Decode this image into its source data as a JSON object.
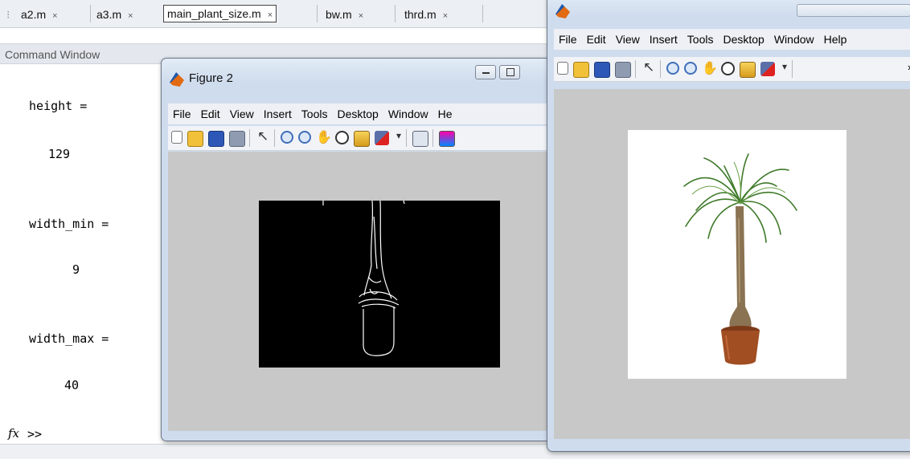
{
  "editor": {
    "tabs": [
      {
        "label": "a2.m",
        "close": "×"
      },
      {
        "label": "a3.m",
        "close": "×"
      },
      {
        "label": "main_plant_size.m",
        "close": "×"
      },
      {
        "label": "bw.m",
        "close": "×"
      },
      {
        "label": "thrd.m",
        "close": "×"
      }
    ]
  },
  "command_window": {
    "title": "Command Window",
    "lines": [
      {
        "text": "height ="
      },
      {
        "text": "129"
      },
      {
        "text": "width_min ="
      },
      {
        "text": "9"
      },
      {
        "text": "width_max ="
      },
      {
        "text": "40"
      }
    ],
    "fx": "fx",
    "prompt": ">>"
  },
  "figure2": {
    "title": "Figure 2",
    "menu": [
      "File",
      "Edit",
      "View",
      "Insert",
      "Tools",
      "Desktop",
      "Window",
      "He"
    ],
    "toolbar_icons": [
      "new-figure-icon",
      "open-file-icon",
      "save-icon",
      "print-icon",
      "pointer-arrow-icon",
      "zoom-in-icon",
      "zoom-out-icon",
      "pan-hand-icon",
      "rotate-3d-icon",
      "data-cursor-icon",
      "brush-icon",
      "dropdown-arrow-icon",
      "link-plot-icon",
      "colorbar-icon"
    ]
  },
  "figure1": {
    "menu": [
      "File",
      "Edit",
      "View",
      "Insert",
      "Tools",
      "Desktop",
      "Window",
      "Help"
    ],
    "overflow": "»",
    "toolbar_icons": [
      "new-figure-icon",
      "open-file-icon",
      "save-icon",
      "print-icon",
      "pointer-arrow-icon",
      "zoom-in-icon",
      "zoom-out-icon",
      "pan-hand-icon",
      "rotate-3d-icon",
      "data-cursor-icon",
      "brush-icon",
      "dropdown-arrow-icon"
    ]
  },
  "colors": {
    "canvas": "#c8c8c8",
    "titlebar": "#cfdced",
    "edge_image_bg": "#000000",
    "plant_leaves": "#3f7a2a",
    "plant_trunk": "#8a7352",
    "pot": "#a04e22"
  }
}
